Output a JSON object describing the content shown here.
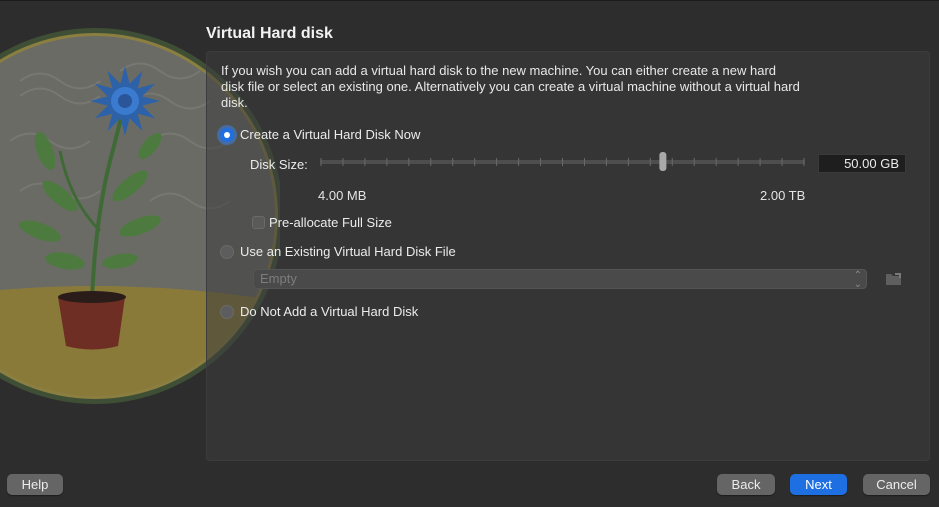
{
  "header": {
    "title": "Virtual Hard disk"
  },
  "description": "If you wish you can add a virtual hard disk to the new machine. You can either create a new hard disk file or select an existing one. Alternatively you can create a virtual machine without a virtual hard disk.",
  "options": {
    "create_now": {
      "label": "Create a Virtual Hard Disk Now",
      "selected": true
    },
    "use_existing": {
      "label": "Use an Existing Virtual Hard Disk File",
      "selected": false
    },
    "do_not_add": {
      "label": "Do Not Add a Virtual Hard Disk",
      "selected": false
    }
  },
  "disk_size": {
    "label": "Disk Size:",
    "value": "50.00 GB",
    "min_label": "4.00 MB",
    "max_label": "2.00 TB",
    "slider_fraction": 0.71
  },
  "preallocate": {
    "label": "Pre-allocate Full Size",
    "checked": false
  },
  "existing_file": {
    "selected_value": "Empty"
  },
  "footer": {
    "help_label": "Help",
    "back_label": "Back",
    "next_label": "Next",
    "cancel_label": "Cancel"
  },
  "colors": {
    "accent": "#1e6fe2",
    "background": "#2d2d2d"
  }
}
